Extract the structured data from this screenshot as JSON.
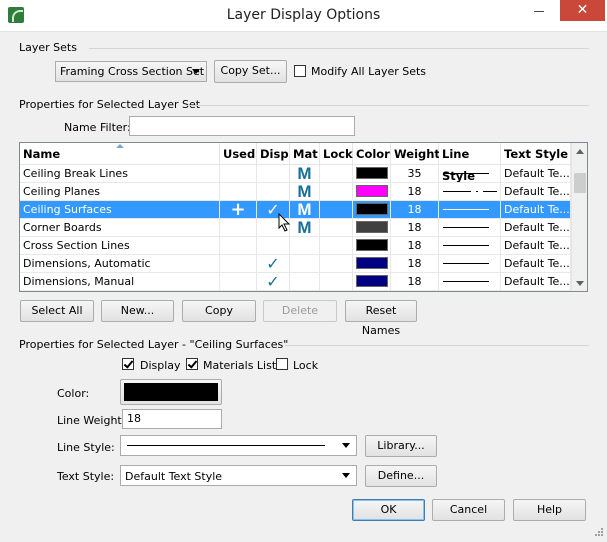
{
  "window": {
    "title": "Layer Display Options",
    "close_label": "✕"
  },
  "layer_sets": {
    "group_label": "Layer Sets",
    "selected_set": "Framing Cross Section Set",
    "copy_set_label": "Copy Set...",
    "modify_all_label": "Modify All Layer Sets",
    "modify_all_checked": false
  },
  "properties_set": {
    "group_label": "Properties for Selected Layer Set",
    "name_filter_label": "Name Filter:",
    "name_filter_value": ""
  },
  "table": {
    "columns": [
      "Name",
      "Used",
      "Disp",
      "Mat",
      "Lock",
      "Color",
      "Weight",
      "Line Style",
      "Text Style"
    ],
    "rows": [
      {
        "name": "Ceiling Break Lines",
        "used": false,
        "disp": false,
        "mat": "M",
        "lock": false,
        "color": "#000000",
        "weight": "35",
        "line_style": "solid",
        "text_style": "Default Te...",
        "selected": false
      },
      {
        "name": "Ceiling Planes",
        "used": false,
        "disp": false,
        "mat": "M",
        "lock": false,
        "color": "#ff00ff",
        "weight": "18",
        "line_style": "dash-dot",
        "text_style": "Default Te...",
        "selected": false
      },
      {
        "name": "Ceiling Surfaces",
        "used": true,
        "disp": true,
        "mat": "M",
        "lock": false,
        "color": "#000000",
        "weight": "18",
        "line_style": "solid",
        "text_style": "Default Te...",
        "selected": true
      },
      {
        "name": "Corner Boards",
        "used": false,
        "disp": false,
        "mat": "M",
        "lock": false,
        "color": "#404040",
        "weight": "18",
        "line_style": "solid",
        "text_style": "Default Te...",
        "selected": false
      },
      {
        "name": "Cross Section Lines",
        "used": false,
        "disp": false,
        "mat": "",
        "lock": false,
        "color": "#000000",
        "weight": "18",
        "line_style": "solid",
        "text_style": "Default Te...",
        "selected": false
      },
      {
        "name": "Dimensions,  Automatic",
        "used": false,
        "disp": true,
        "mat": "",
        "lock": false,
        "color": "#000080",
        "weight": "18",
        "line_style": "solid",
        "text_style": "Default Te...",
        "selected": false
      },
      {
        "name": "Dimensions,  Manual",
        "used": false,
        "disp": true,
        "mat": "",
        "lock": false,
        "color": "#000080",
        "weight": "18",
        "line_style": "solid",
        "text_style": "Default Te...",
        "selected": false
      }
    ],
    "check_glyph": "✓",
    "plus_glyph": "+"
  },
  "table_buttons": {
    "select_all": "Select All",
    "new": "New...",
    "copy": "Copy",
    "delete": "Delete",
    "reset_names": "Reset Names"
  },
  "properties_layer": {
    "group_label": "Properties for Selected Layer - \"Ceiling Surfaces\"",
    "display_label": "Display",
    "display_checked": true,
    "materials_label": "Materials List",
    "materials_checked": true,
    "lock_label": "Lock",
    "lock_checked": false,
    "color_label": "Color:",
    "color_value": "#000000",
    "line_weight_label": "Line Weight:",
    "line_weight_value": "18",
    "line_style_label": "Line Style:",
    "library_label": "Library...",
    "text_style_label": "Text Style:",
    "text_style_value": "Default Text Style",
    "define_label": "Define..."
  },
  "footer": {
    "ok": "OK",
    "cancel": "Cancel",
    "help": "Help"
  }
}
